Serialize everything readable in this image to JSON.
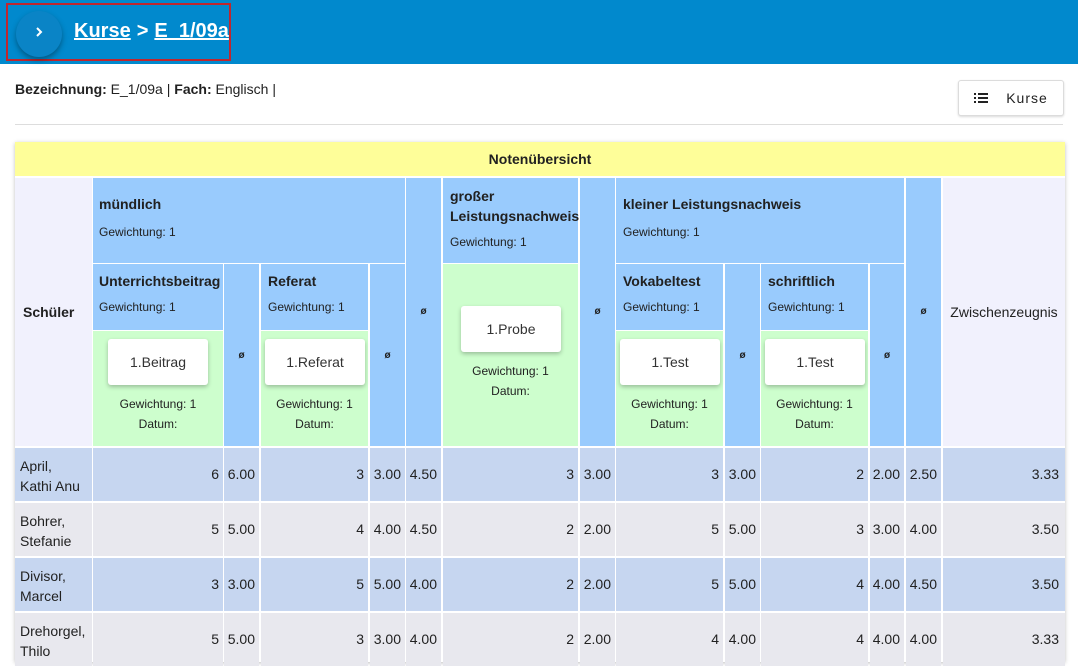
{
  "breadcrumb": {
    "parent": "Kurse",
    "separator": ">",
    "current": "E_1/09a"
  },
  "info": {
    "bezeichnung_label": "Bezeichnung:",
    "bezeichnung_value": "E_1/09a",
    "sep1": "|",
    "fach_label": "Fach:",
    "fach_value": "Englisch",
    "sep2": "|"
  },
  "kurse_button": {
    "label": "Kurse",
    "icon": "list-icon"
  },
  "table": {
    "title": "Notenübersicht",
    "schueler_header": "Schüler",
    "avg_symbol": "ø",
    "zwischenzeugnis_header": "Zwischenzeugnis",
    "muendlich": {
      "name": "mündlich",
      "weight": "Gewichtung: 1"
    },
    "gross": {
      "name": "großer Leistungsnachweis",
      "weight": "Gewichtung: 1"
    },
    "klein": {
      "name": "kleiner Leistungsnachweis",
      "weight": "Gewichtung: 1"
    },
    "sub": {
      "unterricht": {
        "name": "Unterrichtsbeitrag",
        "weight": "Gewichtung: 1",
        "item": "1.Beitrag",
        "item_weight": "Gewichtung: 1",
        "item_date": "Datum:"
      },
      "referat": {
        "name": "Referat",
        "weight": "Gewichtung: 1",
        "item": "1.Referat",
        "item_weight": "Gewichtung: 1",
        "item_date": "Datum:"
      },
      "probe": {
        "item": "1.Probe",
        "item_weight": "Gewichtung: 1",
        "item_date": "Datum:"
      },
      "vokabel": {
        "name": "Vokabeltest",
        "weight": "Gewichtung: 1",
        "item": "1.Test",
        "item_weight": "Gewichtung: 1",
        "item_date": "Datum:"
      },
      "schriftlich": {
        "name": "schriftlich",
        "weight": "Gewichtung: 1",
        "item": "1.Test",
        "item_weight": "Gewichtung: 1",
        "item_date": "Datum:"
      }
    },
    "rows": [
      {
        "line1": "April,",
        "line2": "Kathi Anu",
        "v": [
          "6",
          "6.00",
          "3",
          "3.00",
          "4.50",
          "3",
          "3.00",
          "3",
          "3.00",
          "2",
          "2.00",
          "2.50",
          "3.33"
        ]
      },
      {
        "line1": "Bohrer,",
        "line2": "Stefanie",
        "v": [
          "5",
          "5.00",
          "4",
          "4.00",
          "4.50",
          "2",
          "2.00",
          "5",
          "5.00",
          "3",
          "3.00",
          "4.00",
          "3.50"
        ]
      },
      {
        "line1": "Divisor,",
        "line2": "Marcel",
        "v": [
          "3",
          "3.00",
          "5",
          "5.00",
          "4.00",
          "2",
          "2.00",
          "5",
          "5.00",
          "4",
          "4.00",
          "4.50",
          "3.50"
        ]
      },
      {
        "line1": "Drehorgel,",
        "line2": "Thilo",
        "v": [
          "5",
          "5.00",
          "3",
          "3.00",
          "4.00",
          "2",
          "2.00",
          "4",
          "4.00",
          "4",
          "4.00",
          "4.00",
          "3.33"
        ]
      }
    ]
  }
}
